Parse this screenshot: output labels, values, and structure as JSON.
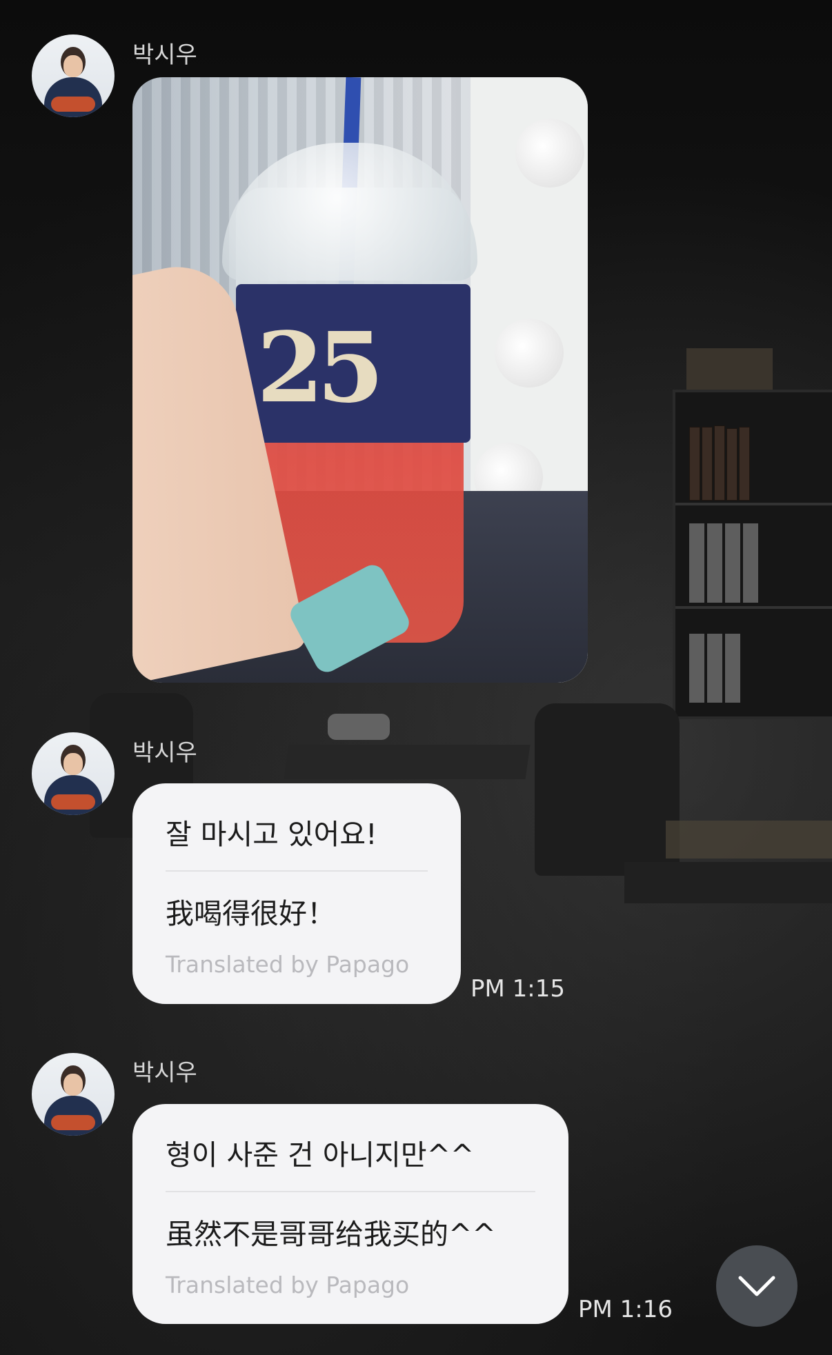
{
  "messages": [
    {
      "sender": "박시우",
      "type": "image",
      "image_caption": "cup-photo"
    },
    {
      "sender": "박시우",
      "original": "잘 마시고 있어요!",
      "translation": "我喝得很好！",
      "translated_by": "Translated by Papago",
      "time": "PM 1:15"
    },
    {
      "sender": "박시우",
      "original": "형이 사준 건 아니지만^^",
      "translation": "虽然不是哥哥给我买的^^",
      "translated_by": "Translated by Papago",
      "time": "PM 1:16"
    }
  ],
  "scroll_button": {
    "icon": "chevron-down-icon"
  }
}
